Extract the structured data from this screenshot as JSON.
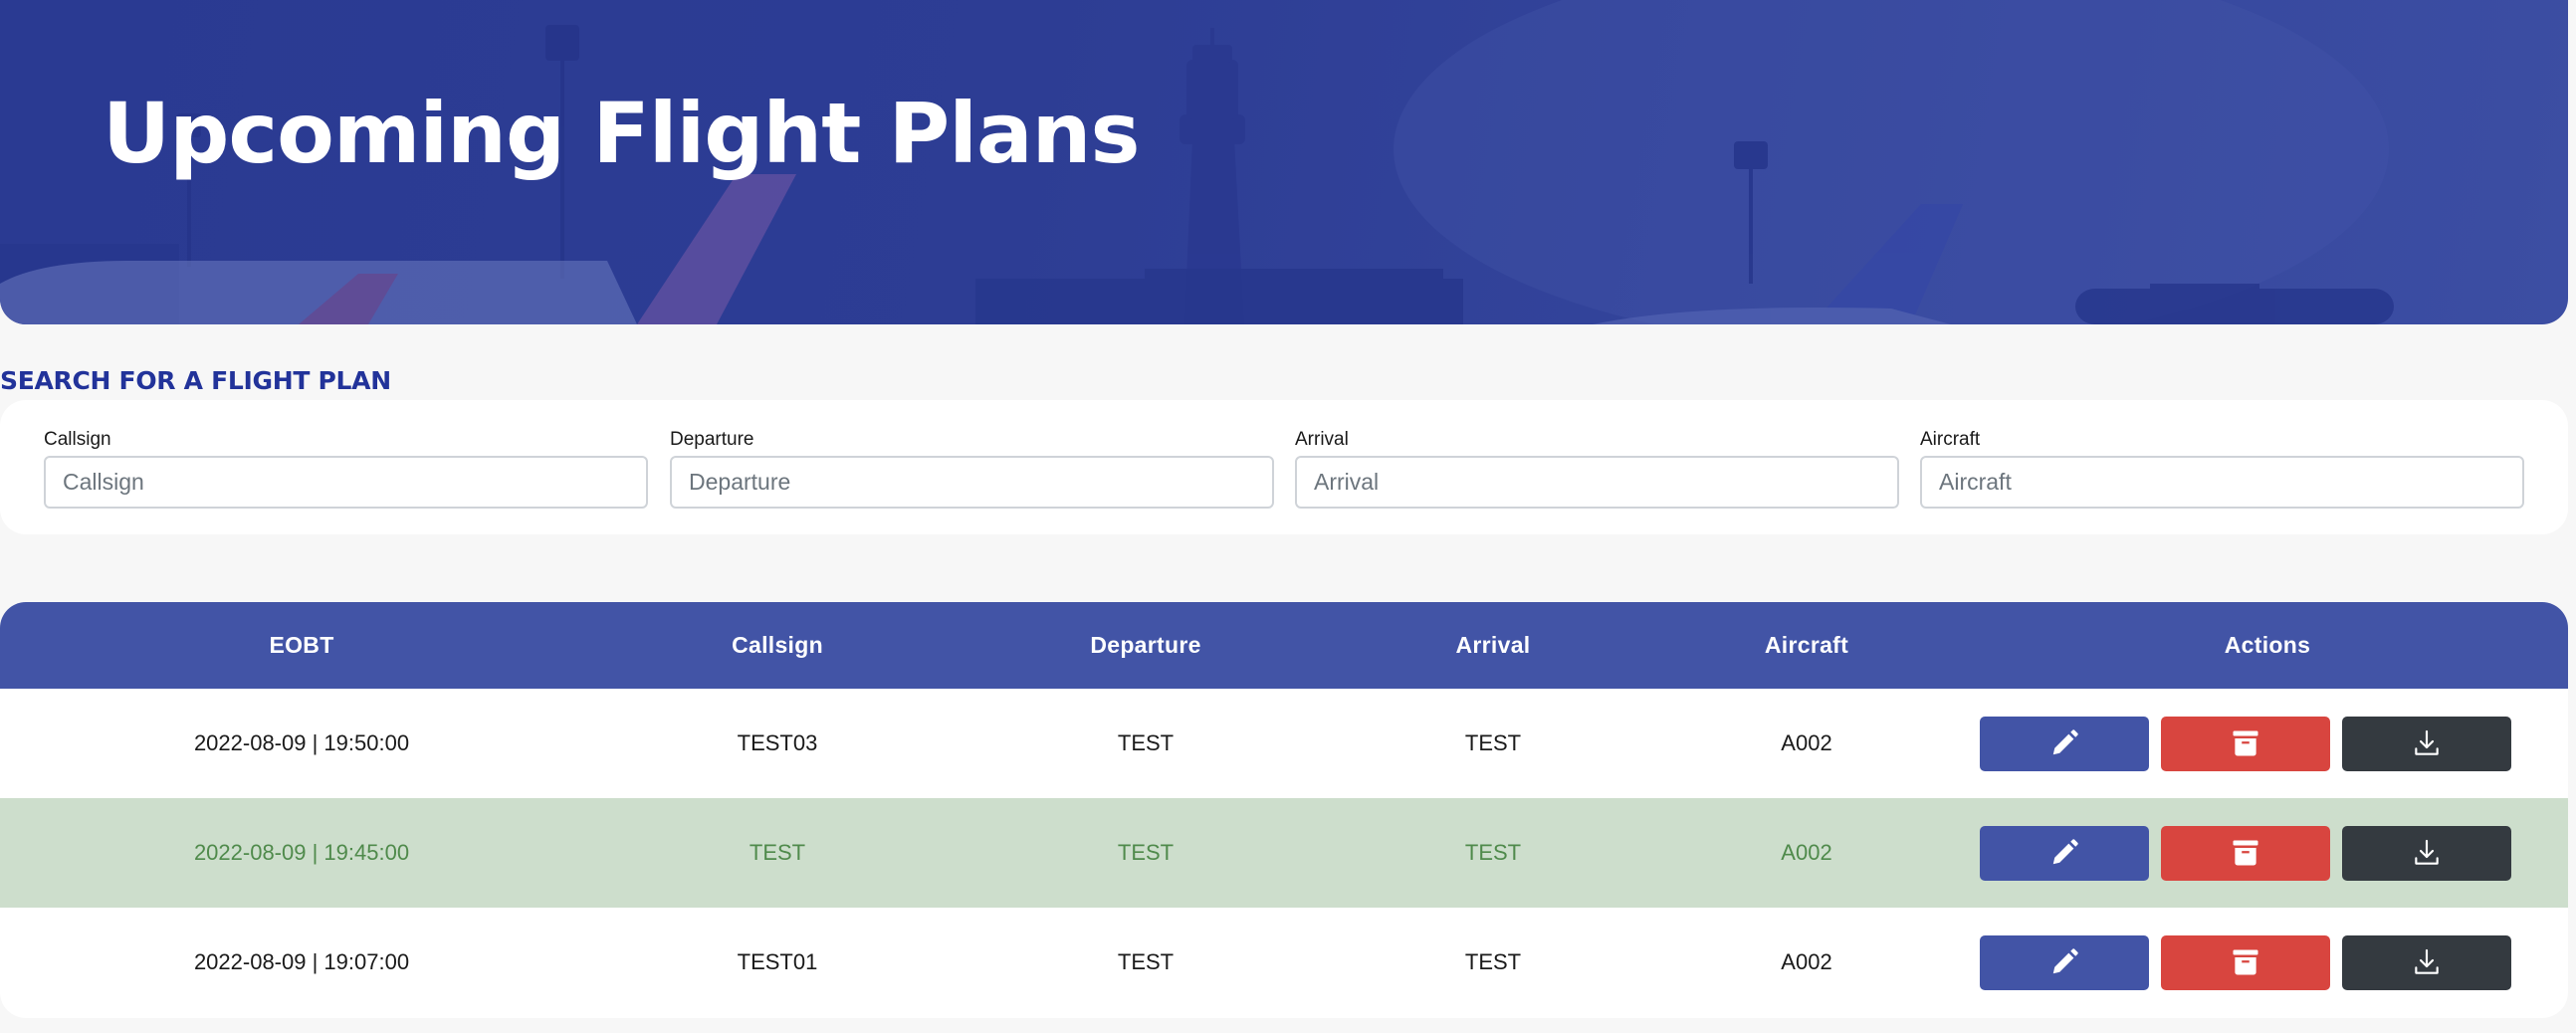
{
  "banner": {
    "title": "Upcoming Flight Plans",
    "background": "airport-apron-with-control-tower-photo"
  },
  "search": {
    "heading": "SEARCH FOR A FLIGHT PLAN",
    "fields": [
      {
        "label": "Callsign",
        "placeholder": "Callsign",
        "value": ""
      },
      {
        "label": "Departure",
        "placeholder": "Departure",
        "value": ""
      },
      {
        "label": "Arrival",
        "placeholder": "Arrival",
        "value": ""
      },
      {
        "label": "Aircraft",
        "placeholder": "Aircraft",
        "value": ""
      }
    ]
  },
  "table": {
    "columns": [
      "EOBT",
      "Callsign",
      "Departure",
      "Arrival",
      "Aircraft",
      "Actions"
    ],
    "rows": [
      {
        "eobt": "2022-08-09 | 19:50:00",
        "callsign": "TEST03",
        "departure": "TEST",
        "arrival": "TEST",
        "aircraft": "A002",
        "highlighted": false
      },
      {
        "eobt": "2022-08-09 | 19:45:00",
        "callsign": "TEST",
        "departure": "TEST",
        "arrival": "TEST",
        "aircraft": "A002",
        "highlighted": true
      },
      {
        "eobt": "2022-08-09 | 19:07:00",
        "callsign": "TEST01",
        "departure": "TEST",
        "arrival": "TEST",
        "aircraft": "A002",
        "highlighted": false
      }
    ],
    "actions": [
      {
        "name": "edit",
        "icon": "pencil-icon"
      },
      {
        "name": "archive",
        "icon": "archive-box-icon"
      },
      {
        "name": "download",
        "icon": "download-icon"
      }
    ]
  },
  "colors": {
    "primary": "#4254a6",
    "danger": "#d8453f",
    "dark": "#343a40",
    "heading": "#22339a",
    "highlight_row_bg": "#cddecc",
    "highlight_row_text": "#4f8a4b"
  }
}
